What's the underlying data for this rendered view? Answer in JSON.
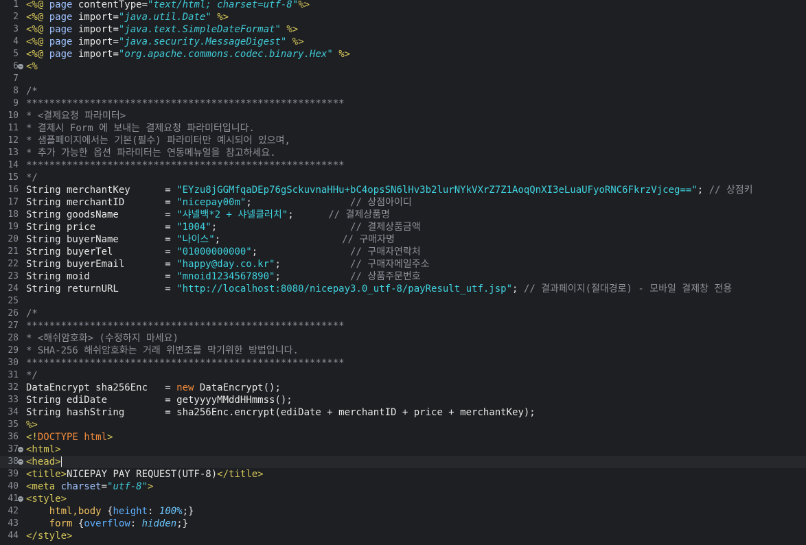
{
  "editor": {
    "current_line": 38,
    "colors": {
      "background": "#1e1f22",
      "tag": "#d6c85a",
      "string": "#3fd3e0",
      "comment": "#8d9199",
      "keyword": "#f08a3c"
    },
    "lines": [
      {
        "n": "1",
        "fold": false,
        "seg": [
          [
            "tag",
            "<%@ "
          ],
          [
            "attr",
            "page "
          ],
          [
            "plain",
            "contentType="
          ],
          [
            "istr",
            "\"text/html; charset=utf-8\""
          ],
          [
            "tag",
            "%>"
          ]
        ]
      },
      {
        "n": "2",
        "fold": false,
        "seg": [
          [
            "tag",
            "<%@ "
          ],
          [
            "attr",
            "page "
          ],
          [
            "plain",
            "import="
          ],
          [
            "istr",
            "\"java.util.Date\""
          ],
          [
            "plain",
            " "
          ],
          [
            "tag",
            "%>"
          ]
        ]
      },
      {
        "n": "3",
        "fold": false,
        "seg": [
          [
            "tag",
            "<%@ "
          ],
          [
            "attr",
            "page "
          ],
          [
            "plain",
            "import="
          ],
          [
            "istr",
            "\"java.text.SimpleDateFormat\""
          ],
          [
            "plain",
            " "
          ],
          [
            "tag",
            "%>"
          ]
        ]
      },
      {
        "n": "4",
        "fold": false,
        "seg": [
          [
            "tag",
            "<%@ "
          ],
          [
            "attr",
            "page "
          ],
          [
            "plain",
            "import="
          ],
          [
            "istr",
            "\"java.security.MessageDigest\""
          ],
          [
            "plain",
            " "
          ],
          [
            "tag",
            "%>"
          ]
        ]
      },
      {
        "n": "5",
        "fold": false,
        "seg": [
          [
            "tag",
            "<%@ "
          ],
          [
            "attr",
            "page "
          ],
          [
            "plain",
            "import="
          ],
          [
            "istr",
            "\"org.apache.commons.codec.binary.Hex\""
          ],
          [
            "plain",
            " "
          ],
          [
            "tag",
            "%>"
          ]
        ]
      },
      {
        "n": "6",
        "fold": true,
        "seg": [
          [
            "tag",
            "<%"
          ]
        ]
      },
      {
        "n": "7",
        "fold": false,
        "seg": []
      },
      {
        "n": "8",
        "fold": false,
        "seg": [
          [
            "com",
            "/*"
          ]
        ]
      },
      {
        "n": "9",
        "fold": false,
        "seg": [
          [
            "com",
            "*******************************************************"
          ]
        ]
      },
      {
        "n": "10",
        "fold": false,
        "seg": [
          [
            "com",
            "* <결제요청 파라미터>"
          ]
        ]
      },
      {
        "n": "11",
        "fold": false,
        "seg": [
          [
            "com",
            "* 결제시 Form 에 보내는 결제요청 파라미터입니다."
          ]
        ]
      },
      {
        "n": "12",
        "fold": false,
        "seg": [
          [
            "com",
            "* 샘플페이지에서는 기본(필수) 파라미터만 예시되어 있으며,"
          ]
        ]
      },
      {
        "n": "13",
        "fold": false,
        "seg": [
          [
            "com",
            "* 추가 가능한 옵션 파라미터는 연동메뉴얼을 참고하세요."
          ]
        ]
      },
      {
        "n": "14",
        "fold": false,
        "seg": [
          [
            "com",
            "*******************************************************"
          ]
        ]
      },
      {
        "n": "15",
        "fold": false,
        "seg": [
          [
            "com",
            "*/"
          ]
        ]
      },
      {
        "n": "16",
        "fold": false,
        "seg": [
          [
            "plain",
            "String merchantKey      = "
          ],
          [
            "str",
            "\"EYzu8jGGMfqaDEp76gSckuvnaHHu+bC4opsSN6lHv3b2lurNYkVXrZ7Z1AoqQnXI3eLuaUFyoRNC6FkrzVjceg==\""
          ],
          [
            "plain",
            "; "
          ],
          [
            "com",
            "// 상점키"
          ]
        ]
      },
      {
        "n": "17",
        "fold": false,
        "seg": [
          [
            "plain",
            "String merchantID       = "
          ],
          [
            "str",
            "\"nicepay00m\""
          ],
          [
            "plain",
            ";                 "
          ],
          [
            "com",
            "// 상점아이디"
          ]
        ]
      },
      {
        "n": "18",
        "fold": false,
        "seg": [
          [
            "plain",
            "String goodsName        = "
          ],
          [
            "str",
            "\"샤넬백*2 + 샤넬클러치\""
          ],
          [
            "plain",
            ";      "
          ],
          [
            "com",
            "// 결제상품명"
          ]
        ]
      },
      {
        "n": "19",
        "fold": false,
        "seg": [
          [
            "plain",
            "String price            = "
          ],
          [
            "str",
            "\"1004\""
          ],
          [
            "plain",
            ";                       "
          ],
          [
            "com",
            "// 결제상품금액"
          ]
        ]
      },
      {
        "n": "20",
        "fold": false,
        "seg": [
          [
            "plain",
            "String buyerName        = "
          ],
          [
            "str",
            "\"나이스\""
          ],
          [
            "plain",
            ";                     "
          ],
          [
            "com",
            "// 구매자명"
          ]
        ]
      },
      {
        "n": "21",
        "fold": false,
        "seg": [
          [
            "plain",
            "String buyerTel         = "
          ],
          [
            "str",
            "\"01000000000\""
          ],
          [
            "plain",
            ";                "
          ],
          [
            "com",
            "// 구매자연락처"
          ]
        ]
      },
      {
        "n": "22",
        "fold": false,
        "seg": [
          [
            "plain",
            "String buyerEmail       = "
          ],
          [
            "str",
            "\"happy@day.co.kr\""
          ],
          [
            "plain",
            ";            "
          ],
          [
            "com",
            "// 구매자메일주소"
          ]
        ]
      },
      {
        "n": "23",
        "fold": false,
        "seg": [
          [
            "plain",
            "String moid             = "
          ],
          [
            "str",
            "\"mnoid1234567890\""
          ],
          [
            "plain",
            ";            "
          ],
          [
            "com",
            "// 상품주문번호"
          ]
        ]
      },
      {
        "n": "24",
        "fold": false,
        "seg": [
          [
            "plain",
            "String returnURL        = "
          ],
          [
            "str",
            "\"http://localhost:8080/nicepay3.0_utf-8/payResult_utf.jsp\""
          ],
          [
            "plain",
            "; "
          ],
          [
            "com",
            "// 결과페이지(절대경로) - 모바일 결제창 전용"
          ]
        ]
      },
      {
        "n": "25",
        "fold": false,
        "seg": []
      },
      {
        "n": "26",
        "fold": false,
        "seg": [
          [
            "com",
            "/*"
          ]
        ]
      },
      {
        "n": "27",
        "fold": false,
        "seg": [
          [
            "com",
            "*******************************************************"
          ]
        ]
      },
      {
        "n": "28",
        "fold": false,
        "seg": [
          [
            "com",
            "* <해쉬암호화> (수정하지 마세요)"
          ]
        ]
      },
      {
        "n": "29",
        "fold": false,
        "seg": [
          [
            "com",
            "* SHA-256 해쉬암호화는 거래 위변조를 막기위한 방법입니다."
          ]
        ]
      },
      {
        "n": "30",
        "fold": false,
        "seg": [
          [
            "com",
            "*******************************************************"
          ]
        ]
      },
      {
        "n": "31",
        "fold": false,
        "seg": [
          [
            "com",
            "*/"
          ]
        ]
      },
      {
        "n": "32",
        "fold": false,
        "seg": [
          [
            "plain",
            "DataEncrypt sha256Enc   = "
          ],
          [
            "kw",
            "new"
          ],
          [
            "plain",
            " DataEncrypt();"
          ]
        ]
      },
      {
        "n": "33",
        "fold": false,
        "seg": [
          [
            "plain",
            "String ediDate          = getyyyyMMddHHmmss();"
          ]
        ]
      },
      {
        "n": "34",
        "fold": false,
        "seg": [
          [
            "plain",
            "String hashString       = sha256Enc.encrypt(ediDate + merchantID + price + merchantKey);"
          ]
        ]
      },
      {
        "n": "35",
        "fold": false,
        "seg": [
          [
            "tag",
            "%>"
          ]
        ]
      },
      {
        "n": "36",
        "fold": false,
        "seg": [
          [
            "tag",
            "<!"
          ],
          [
            "kw",
            "DOCTYPE"
          ],
          [
            "plain",
            " "
          ],
          [
            "kw",
            "html"
          ],
          [
            "tag",
            ">"
          ]
        ]
      },
      {
        "n": "37",
        "fold": true,
        "seg": [
          [
            "tag",
            "<html>"
          ]
        ]
      },
      {
        "n": "38",
        "fold": true,
        "seg": [
          [
            "tag",
            "<head>"
          ]
        ],
        "caret": true
      },
      {
        "n": "39",
        "fold": false,
        "seg": [
          [
            "tag",
            "<title>"
          ],
          [
            "plain",
            "NICEPAY PAY REQUEST(UTF-8)"
          ],
          [
            "tag",
            "</title>"
          ]
        ]
      },
      {
        "n": "40",
        "fold": false,
        "seg": [
          [
            "tag",
            "<meta "
          ],
          [
            "attr",
            "charset"
          ],
          [
            "plain",
            "="
          ],
          [
            "istr",
            "\"utf-8\""
          ],
          [
            "tag",
            ">"
          ]
        ]
      },
      {
        "n": "41",
        "fold": true,
        "seg": [
          [
            "tag",
            "<style>"
          ]
        ]
      },
      {
        "n": "42",
        "fold": false,
        "seg": [
          [
            "plain",
            "    "
          ],
          [
            "css",
            "html,body "
          ],
          [
            "plain",
            "{"
          ],
          [
            "cssprop",
            "height"
          ],
          [
            "plain",
            ": "
          ],
          [
            "cssval",
            "100%"
          ],
          [
            "plain",
            ";}"
          ]
        ]
      },
      {
        "n": "43",
        "fold": false,
        "seg": [
          [
            "plain",
            "    "
          ],
          [
            "css",
            "form "
          ],
          [
            "plain",
            "{"
          ],
          [
            "cssprop",
            "overflow"
          ],
          [
            "plain",
            ": "
          ],
          [
            "cssval",
            "hidden"
          ],
          [
            "plain",
            ";}"
          ]
        ]
      },
      {
        "n": "44",
        "fold": false,
        "seg": [
          [
            "tag",
            "</style>"
          ]
        ]
      }
    ]
  }
}
